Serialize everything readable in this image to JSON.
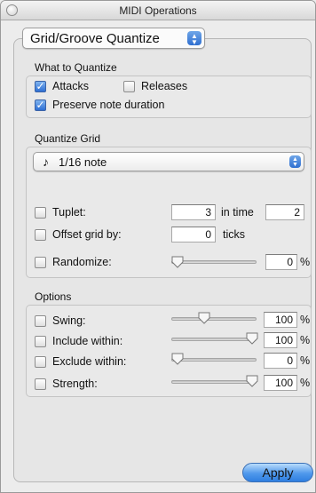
{
  "window": {
    "title": "MIDI Operations"
  },
  "mode": {
    "selected": "Grid/Groove Quantize"
  },
  "what_to_quantize": {
    "title": "What to Quantize",
    "attacks": {
      "label": "Attacks",
      "checked": true
    },
    "releases": {
      "label": "Releases",
      "checked": false
    },
    "preserve": {
      "label": "Preserve note duration",
      "checked": true
    }
  },
  "quantize_grid": {
    "title": "Quantize Grid",
    "grid_value": "1/16 note",
    "note_glyph": "♪",
    "tuplet": {
      "label": "Tuplet:",
      "value": "3",
      "in_time_label": "in time",
      "in_time_value": "2",
      "checked": false
    },
    "offset": {
      "label": "Offset grid by:",
      "value": "0",
      "unit": "ticks",
      "checked": false
    },
    "randomize": {
      "label": "Randomize:",
      "value": "0",
      "unit": "%",
      "checked": false,
      "level": 0
    }
  },
  "options": {
    "title": "Options",
    "swing": {
      "label": "Swing:",
      "value": "100",
      "unit": "%",
      "checked": false,
      "level": 0.5
    },
    "include": {
      "label": "Include within:",
      "value": "100",
      "unit": "%",
      "checked": false,
      "level": 1.0
    },
    "exclude": {
      "label": "Exclude within:",
      "value": "0",
      "unit": "%",
      "checked": false,
      "level": 0
    },
    "strength": {
      "label": "Strength:",
      "value": "100",
      "unit": "%",
      "checked": false,
      "level": 1.0
    }
  },
  "apply": {
    "label": "Apply"
  }
}
